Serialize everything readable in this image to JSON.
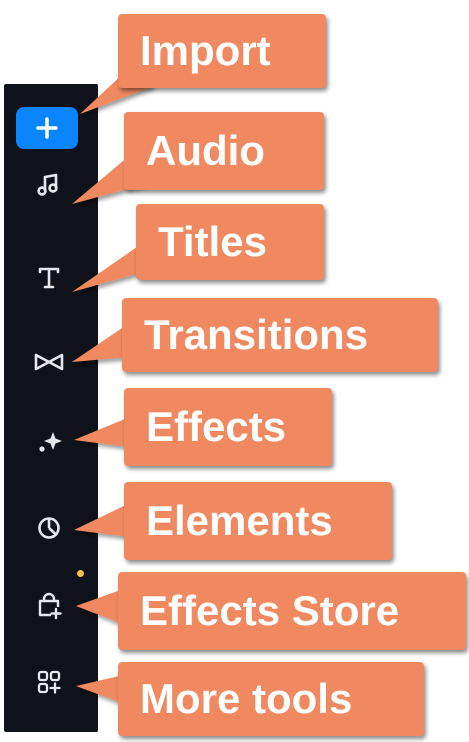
{
  "sidebar": {
    "items": [
      {
        "icon": "plus-icon",
        "active": true
      },
      {
        "icon": "music-note-icon"
      },
      {
        "icon": "text-t-icon"
      },
      {
        "icon": "transitions-icon"
      },
      {
        "icon": "sparkle-effects-icon"
      },
      {
        "icon": "elements-pie-icon"
      },
      {
        "icon": "store-bag-plus-icon"
      },
      {
        "icon": "grid-plus-icon",
        "badge": "new-dot"
      }
    ],
    "accent": "#0a84ff",
    "background": "#0f1218",
    "badge_color": "#f2c14b"
  },
  "callouts": {
    "color": "#f0895f",
    "import": "Import",
    "audio": "Audio",
    "titles": "Titles",
    "transitions": "Transitions",
    "effects": "Effects",
    "elements": "Elements",
    "effects_store": "Effects Store",
    "more_tools": "More tools"
  }
}
